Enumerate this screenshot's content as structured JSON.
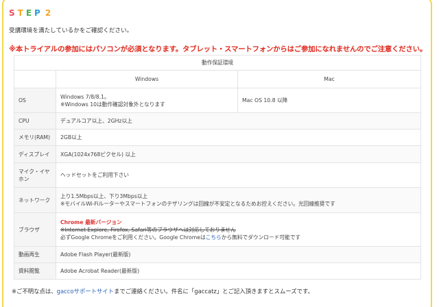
{
  "step_logo": {
    "letters": [
      "S",
      "T",
      "E",
      "P",
      "2"
    ],
    "colors": [
      "#e84a5f",
      "#f5a623",
      "#4caf50",
      "#2e9bd6",
      "#f5a623"
    ]
  },
  "intro": "受講環境を満たしているかをご確認ください。",
  "warning": "※本トライアルの参加にはパソコンが必須となります。タブレット・スマートフォンからはご参加になれませんのでご注意ください。",
  "table": {
    "caption": "動作保証環境",
    "col_windows": "Windows",
    "col_mac": "Mac",
    "os_label": "OS",
    "os_win_1": "Windows 7/8/8.1。",
    "os_win_2": "※Windows 10は動作確認対象外となります",
    "os_mac": "Mac OS 10.8 以降",
    "cpu_label": "CPU",
    "cpu_val": "デュアルコア以上、2GHz以上",
    "mem_label": "メモリ(RAM)",
    "mem_val": "2GB以上",
    "display_label": "ディスプレイ",
    "display_val": "XGA(1024x768ピクセル) 以上",
    "mic_label": "マイク・イヤホン",
    "mic_val": "ヘッドセットをご利用下さい",
    "net_label": "ネットワーク",
    "net_val_1": "上り1.5Mbps以上、下り3Mbps以上",
    "net_val_2": "※モバイルWi-Fiルーターやスマートフォンのテザリングは回線が不安定となるためお控えください。光回線推奨です",
    "browser_label": "ブラウザ",
    "browser_val_1": "Chrome 最新バージョン",
    "browser_val_2": "※Internet Explore, Firefox, Safari等のブラウザへは対応しておりません",
    "browser_val_3a": "必ずGoogle Chromeをご利用ください。Google Chromeは",
    "browser_val_3b": "こちら",
    "browser_val_3c": "から無料でダウンロード可能です",
    "video_label": "動画再生",
    "video_val": "Adobe Flash Player(最新版)",
    "doc_label": "資料閲覧",
    "doc_val": "Adobe Acrobat Reader(最新版)"
  },
  "footer": {
    "pre": "※ご不明な点は、",
    "link": "gaccoサポートサイト",
    "post": "までご連絡ください。件名に「gaccatz」とご記入頂きますとスムーズです。"
  }
}
